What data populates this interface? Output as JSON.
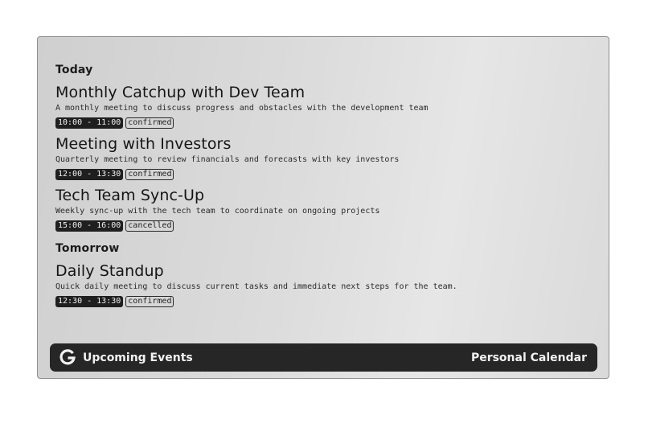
{
  "sections": [
    {
      "title": "Today",
      "events": [
        {
          "title": "Monthly Catchup with Dev Team",
          "description": "A monthly meeting to discuss progress and obstacles with the development team",
          "time": "10:00 - 11:00",
          "status": "confirmed"
        },
        {
          "title": "Meeting with Investors",
          "description": "Quarterly meeting to review financials and forecasts with key investors",
          "time": "12:00 - 13:30",
          "status": "confirmed"
        },
        {
          "title": "Tech Team Sync-Up",
          "description": "Weekly sync-up with the tech team to coordinate on ongoing projects",
          "time": "15:00 - 16:00",
          "status": "cancelled"
        }
      ]
    },
    {
      "title": "Tomorrow",
      "events": [
        {
          "title": "Daily Standup",
          "description": "Quick daily meeting to discuss current tasks and immediate next steps for the team.",
          "time": "12:30 - 13:30",
          "status": "confirmed"
        }
      ]
    }
  ],
  "footer": {
    "icon": "google-g-icon",
    "title": "Upcoming Events",
    "calendar_name": "Personal Calendar"
  },
  "colors": {
    "footer_background": "#262626",
    "time_pill_background": "#1f1f1f",
    "screen_background": "#dcdcdc"
  }
}
